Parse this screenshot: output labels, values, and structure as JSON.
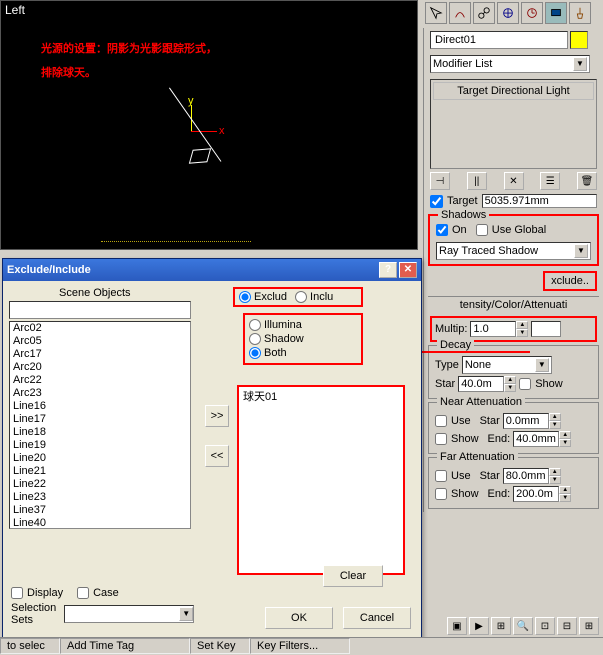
{
  "viewport": {
    "label": "Left",
    "annotation_line1": "光源的设置：阴影为光影跟踪形式，",
    "annotation_line2": "排除球天。",
    "axis_x": "x",
    "axis_y": "y"
  },
  "toolbar_icons": [
    "arrow",
    "arc",
    "link",
    "globe",
    "clock",
    "monitor",
    "hammer"
  ],
  "command_panel": {
    "object_name": "Direct01",
    "modifier_list_label": "Modifier List",
    "stack_item": "Target Directional Light",
    "stack_icons": [
      "pin",
      "vbar",
      "cross",
      "bracket",
      "trash"
    ]
  },
  "general_params": {
    "target_label": "Target",
    "target_value": "5035.971mm"
  },
  "shadows": {
    "title": "Shadows",
    "on_label": "On",
    "on_checked": true,
    "use_global_label": "Use Global",
    "use_global_checked": false,
    "type": "Ray Traced Shadow",
    "exclude_btn": "xclude.."
  },
  "intensity": {
    "title": "tensity/Color/Attenuati",
    "multip_label": "Multip:",
    "multip_value": "1.0"
  },
  "decay": {
    "title": "Decay",
    "type_label": "Type",
    "type_value": "None",
    "start_label": "Star",
    "start_value": "40.0m",
    "show_label": "Show"
  },
  "near_atten": {
    "title": "Near Attenuation",
    "use_label": "Use",
    "show_label": "Show",
    "start_label": "Star",
    "start_value": "0.0mm",
    "end_label": "End:",
    "end_value": "40.0mm"
  },
  "far_atten": {
    "title": "Far Attenuation",
    "use_label": "Use",
    "show_label": "Show",
    "start_label": "Star",
    "start_value": "80.0mm",
    "end_label": "End:",
    "end_value": "200.0m"
  },
  "dialog": {
    "title": "Exclude/Include",
    "scene_objects_label": "Scene Objects",
    "exclude_label": "Exclud",
    "include_label": "Inclu",
    "illum_label": "Illumina",
    "shadow_label": "Shadow",
    "both_label": "Both",
    "items": [
      "Arc02",
      "Arc05",
      "Arc17",
      "Arc20",
      "Arc22",
      "Arc23",
      "Line16",
      "Line17",
      "Line18",
      "Line19",
      "Line20",
      "Line21",
      "Line22",
      "Line23",
      "Line37",
      "Line40"
    ],
    "excluded_item": "球天01",
    "move_right": ">>",
    "move_left": "<<",
    "display_label": "Display",
    "case_label": "Case",
    "selection_sets_label": "Selection\nSets",
    "clear_btn": "Clear",
    "ok_btn": "OK",
    "cancel_btn": "Cancel"
  },
  "status": {
    "cell1": "to selec",
    "cell2": "Add Time Tag",
    "cell3": "Set Key",
    "cell4": "Key Filters..."
  },
  "play_icons": [
    "|◀",
    "▶▶",
    "◀",
    "🔍",
    "⊞",
    "⊡",
    "⊟"
  ]
}
